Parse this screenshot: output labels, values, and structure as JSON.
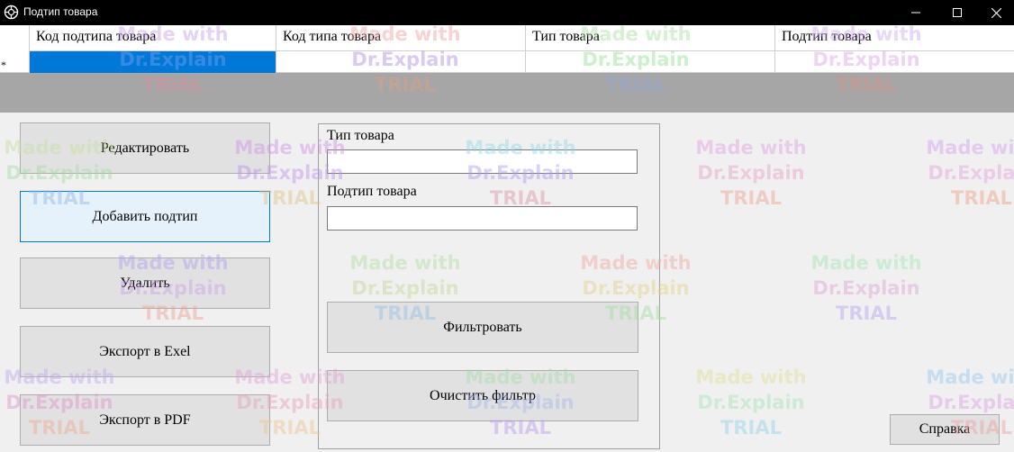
{
  "window": {
    "title": "Подтип товара",
    "controls": {
      "minimize": "—",
      "maximize": "☐",
      "close": "✕"
    }
  },
  "grid": {
    "columns": [
      "Код подтипа товара",
      "Код типа товара",
      "Тип товара",
      "Подтип товара"
    ],
    "new_row_marker": "*"
  },
  "buttons": {
    "edit": "Редактировать",
    "add_subtype": "Добавить подтип",
    "delete": "Удалить",
    "export_excel": "Экспорт в Exel",
    "export_pdf": "Экспорт в PDF",
    "filter": "Фильтровать",
    "clear_filter": "Очистить фильтр",
    "help": "Справка"
  },
  "filter": {
    "type_label": "Тип товара",
    "type_value": "",
    "subtype_label": "Подтип товара",
    "subtype_value": ""
  },
  "watermark": {
    "line1": "Made with",
    "line2": "Dr.Explain",
    "line3": "TRIAL"
  },
  "colors": {
    "titlebar": "#000000",
    "selection": "#0078d7",
    "grid_background": "#a6a6a6",
    "form_background": "#f0f0f0"
  }
}
